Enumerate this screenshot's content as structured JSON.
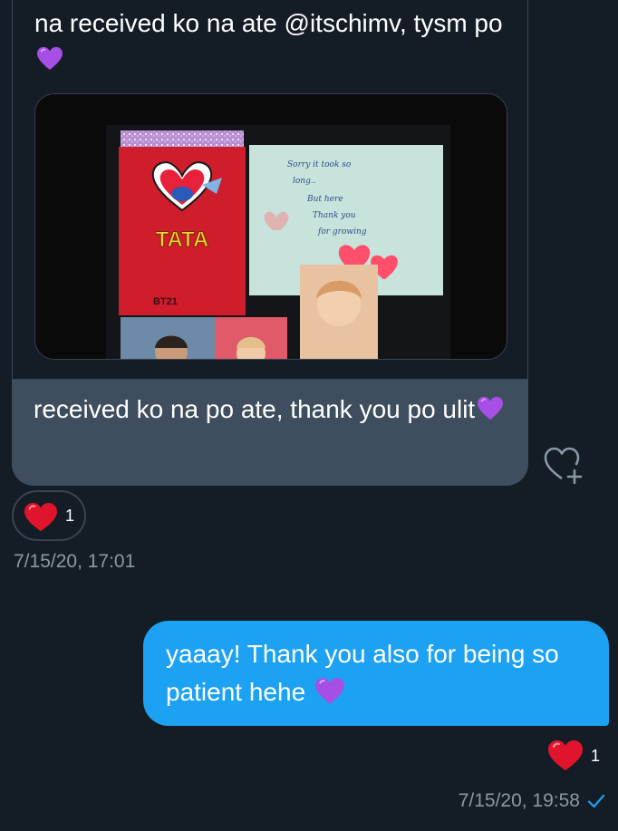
{
  "conversation": {
    "received": {
      "quoted_text": "na received ko na ate @itschimv, tysm po",
      "photo": {
        "card_text": "TATA",
        "card_brand": "BT21",
        "note_lines": [
          "Sorry it took so",
          "long..",
          "But here",
          "Thank you",
          "for growing"
        ]
      },
      "reply_text": "received ko na po ate, thank you po ulit",
      "reaction": {
        "icon": "heart-icon",
        "count": "1"
      },
      "timestamp": "7/15/20, 17:01"
    },
    "sent": {
      "text": "yaaay! Thank you also for being so patient hehe",
      "reaction": {
        "icon": "heart-icon",
        "count": "1"
      },
      "timestamp": "7/15/20, 19:58",
      "status_icon": "checkmark-icon"
    }
  },
  "colors": {
    "background": "#141d26",
    "received_bubble": "#3f4e5e",
    "sent_bubble": "#1da1f2",
    "timestamp": "#8899a6",
    "reaction_red": "#e0245e",
    "emoji_purple": "#a64ee6"
  }
}
